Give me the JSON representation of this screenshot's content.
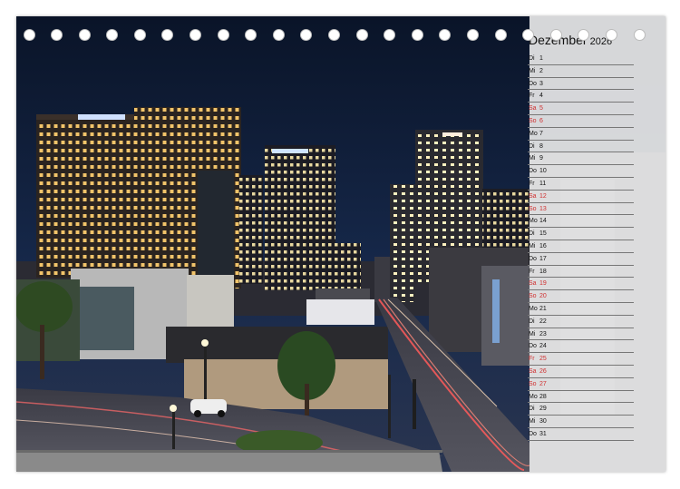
{
  "calendar": {
    "month": "Dezember",
    "year": "2026",
    "days": [
      {
        "wd": "Di",
        "d": "1",
        "weekend": false
      },
      {
        "wd": "Mi",
        "d": "2",
        "weekend": false
      },
      {
        "wd": "Do",
        "d": "3",
        "weekend": false
      },
      {
        "wd": "Fr",
        "d": "4",
        "weekend": false
      },
      {
        "wd": "Sa",
        "d": "5",
        "weekend": true
      },
      {
        "wd": "So",
        "d": "6",
        "weekend": true
      },
      {
        "wd": "Mo",
        "d": "7",
        "weekend": false
      },
      {
        "wd": "Di",
        "d": "8",
        "weekend": false
      },
      {
        "wd": "Mi",
        "d": "9",
        "weekend": false
      },
      {
        "wd": "Do",
        "d": "10",
        "weekend": false
      },
      {
        "wd": "Fr",
        "d": "11",
        "weekend": false
      },
      {
        "wd": "Sa",
        "d": "12",
        "weekend": true
      },
      {
        "wd": "So",
        "d": "13",
        "weekend": true
      },
      {
        "wd": "Mo",
        "d": "14",
        "weekend": false
      },
      {
        "wd": "Di",
        "d": "15",
        "weekend": false
      },
      {
        "wd": "Mi",
        "d": "16",
        "weekend": false
      },
      {
        "wd": "Do",
        "d": "17",
        "weekend": false
      },
      {
        "wd": "Fr",
        "d": "18",
        "weekend": false
      },
      {
        "wd": "Sa",
        "d": "19",
        "weekend": true
      },
      {
        "wd": "So",
        "d": "20",
        "weekend": true
      },
      {
        "wd": "Mo",
        "d": "21",
        "weekend": false
      },
      {
        "wd": "Di",
        "d": "22",
        "weekend": false
      },
      {
        "wd": "Mi",
        "d": "23",
        "weekend": false
      },
      {
        "wd": "Do",
        "d": "24",
        "weekend": false
      },
      {
        "wd": "Fr",
        "d": "25",
        "weekend": true
      },
      {
        "wd": "Sa",
        "d": "26",
        "weekend": true
      },
      {
        "wd": "So",
        "d": "27",
        "weekend": true
      },
      {
        "wd": "Mo",
        "d": "28",
        "weekend": false
      },
      {
        "wd": "Di",
        "d": "29",
        "weekend": false
      },
      {
        "wd": "Mi",
        "d": "30",
        "weekend": false
      },
      {
        "wd": "Do",
        "d": "31",
        "weekend": false
      }
    ]
  },
  "colors": {
    "weekend": "#d03030",
    "sky": "#0b1a33",
    "panel": "#ececec"
  },
  "binding": {
    "hole_count": 23,
    "icon": "binding-hole-icon"
  },
  "photo": {
    "icon": "night-city-photo"
  }
}
